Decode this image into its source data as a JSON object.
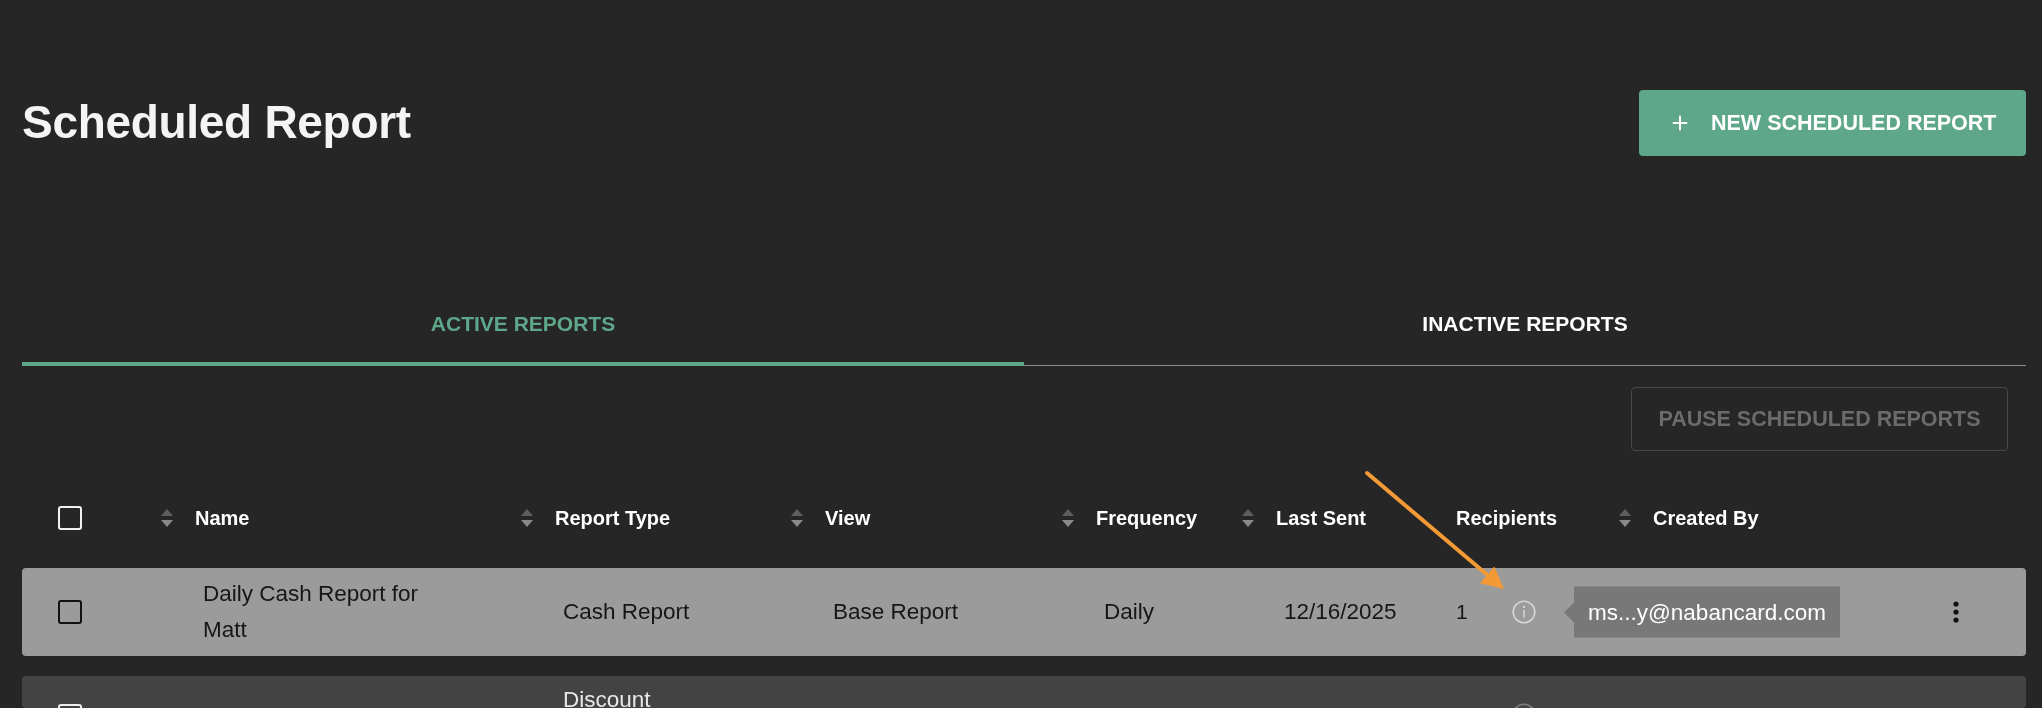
{
  "page": {
    "title": "Scheduled Report"
  },
  "new_button": {
    "label": "NEW SCHEDULED REPORT"
  },
  "tabs": [
    {
      "label": "ACTIVE REPORTS",
      "selected": true
    },
    {
      "label": "INACTIVE REPORTS",
      "selected": false
    }
  ],
  "pause_button": {
    "label": "PAUSE SCHEDULED REPORTS",
    "disabled": true
  },
  "table": {
    "select_all": {
      "checked": false
    },
    "columns": [
      {
        "label": "Name",
        "sortable": true
      },
      {
        "label": "Report Type",
        "sortable": true
      },
      {
        "label": "View",
        "sortable": true
      },
      {
        "label": "Frequency",
        "sortable": true
      },
      {
        "label": "Last Sent",
        "sortable": true
      },
      {
        "label": "Recipients",
        "sortable": false
      },
      {
        "label": "Created By",
        "sortable": true
      }
    ],
    "rows": [
      {
        "checked": false,
        "highlighted": true,
        "name": "Daily Cash Report for Matt",
        "report_type": "Cash Report",
        "view": "Base Report",
        "frequency": "Daily",
        "last_sent": "12/16/2025",
        "recipients": "1",
        "tooltip": "ms...y@nabancard.com"
      },
      {
        "checked": false,
        "highlighted": false,
        "report_type": "Discount"
      }
    ]
  }
}
